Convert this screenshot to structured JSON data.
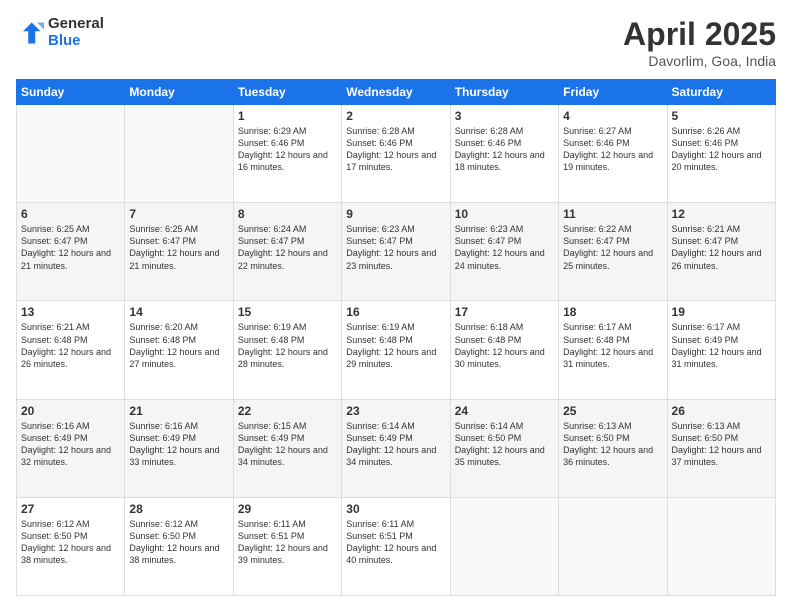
{
  "header": {
    "logo_line1": "General",
    "logo_line2": "Blue",
    "month_title": "April 2025",
    "subtitle": "Davorlim, Goa, India"
  },
  "weekdays": [
    "Sunday",
    "Monday",
    "Tuesday",
    "Wednesday",
    "Thursday",
    "Friday",
    "Saturday"
  ],
  "weeks": [
    [
      {
        "day": null
      },
      {
        "day": null
      },
      {
        "day": "1",
        "sunrise": "Sunrise: 6:29 AM",
        "sunset": "Sunset: 6:46 PM",
        "daylight": "Daylight: 12 hours and 16 minutes."
      },
      {
        "day": "2",
        "sunrise": "Sunrise: 6:28 AM",
        "sunset": "Sunset: 6:46 PM",
        "daylight": "Daylight: 12 hours and 17 minutes."
      },
      {
        "day": "3",
        "sunrise": "Sunrise: 6:28 AM",
        "sunset": "Sunset: 6:46 PM",
        "daylight": "Daylight: 12 hours and 18 minutes."
      },
      {
        "day": "4",
        "sunrise": "Sunrise: 6:27 AM",
        "sunset": "Sunset: 6:46 PM",
        "daylight": "Daylight: 12 hours and 19 minutes."
      },
      {
        "day": "5",
        "sunrise": "Sunrise: 6:26 AM",
        "sunset": "Sunset: 6:46 PM",
        "daylight": "Daylight: 12 hours and 20 minutes."
      }
    ],
    [
      {
        "day": "6",
        "sunrise": "Sunrise: 6:25 AM",
        "sunset": "Sunset: 6:47 PM",
        "daylight": "Daylight: 12 hours and 21 minutes."
      },
      {
        "day": "7",
        "sunrise": "Sunrise: 6:25 AM",
        "sunset": "Sunset: 6:47 PM",
        "daylight": "Daylight: 12 hours and 21 minutes."
      },
      {
        "day": "8",
        "sunrise": "Sunrise: 6:24 AM",
        "sunset": "Sunset: 6:47 PM",
        "daylight": "Daylight: 12 hours and 22 minutes."
      },
      {
        "day": "9",
        "sunrise": "Sunrise: 6:23 AM",
        "sunset": "Sunset: 6:47 PM",
        "daylight": "Daylight: 12 hours and 23 minutes."
      },
      {
        "day": "10",
        "sunrise": "Sunrise: 6:23 AM",
        "sunset": "Sunset: 6:47 PM",
        "daylight": "Daylight: 12 hours and 24 minutes."
      },
      {
        "day": "11",
        "sunrise": "Sunrise: 6:22 AM",
        "sunset": "Sunset: 6:47 PM",
        "daylight": "Daylight: 12 hours and 25 minutes."
      },
      {
        "day": "12",
        "sunrise": "Sunrise: 6:21 AM",
        "sunset": "Sunset: 6:47 PM",
        "daylight": "Daylight: 12 hours and 26 minutes."
      }
    ],
    [
      {
        "day": "13",
        "sunrise": "Sunrise: 6:21 AM",
        "sunset": "Sunset: 6:48 PM",
        "daylight": "Daylight: 12 hours and 26 minutes."
      },
      {
        "day": "14",
        "sunrise": "Sunrise: 6:20 AM",
        "sunset": "Sunset: 6:48 PM",
        "daylight": "Daylight: 12 hours and 27 minutes."
      },
      {
        "day": "15",
        "sunrise": "Sunrise: 6:19 AM",
        "sunset": "Sunset: 6:48 PM",
        "daylight": "Daylight: 12 hours and 28 minutes."
      },
      {
        "day": "16",
        "sunrise": "Sunrise: 6:19 AM",
        "sunset": "Sunset: 6:48 PM",
        "daylight": "Daylight: 12 hours and 29 minutes."
      },
      {
        "day": "17",
        "sunrise": "Sunrise: 6:18 AM",
        "sunset": "Sunset: 6:48 PM",
        "daylight": "Daylight: 12 hours and 30 minutes."
      },
      {
        "day": "18",
        "sunrise": "Sunrise: 6:17 AM",
        "sunset": "Sunset: 6:48 PM",
        "daylight": "Daylight: 12 hours and 31 minutes."
      },
      {
        "day": "19",
        "sunrise": "Sunrise: 6:17 AM",
        "sunset": "Sunset: 6:49 PM",
        "daylight": "Daylight: 12 hours and 31 minutes."
      }
    ],
    [
      {
        "day": "20",
        "sunrise": "Sunrise: 6:16 AM",
        "sunset": "Sunset: 6:49 PM",
        "daylight": "Daylight: 12 hours and 32 minutes."
      },
      {
        "day": "21",
        "sunrise": "Sunrise: 6:16 AM",
        "sunset": "Sunset: 6:49 PM",
        "daylight": "Daylight: 12 hours and 33 minutes."
      },
      {
        "day": "22",
        "sunrise": "Sunrise: 6:15 AM",
        "sunset": "Sunset: 6:49 PM",
        "daylight": "Daylight: 12 hours and 34 minutes."
      },
      {
        "day": "23",
        "sunrise": "Sunrise: 6:14 AM",
        "sunset": "Sunset: 6:49 PM",
        "daylight": "Daylight: 12 hours and 34 minutes."
      },
      {
        "day": "24",
        "sunrise": "Sunrise: 6:14 AM",
        "sunset": "Sunset: 6:50 PM",
        "daylight": "Daylight: 12 hours and 35 minutes."
      },
      {
        "day": "25",
        "sunrise": "Sunrise: 6:13 AM",
        "sunset": "Sunset: 6:50 PM",
        "daylight": "Daylight: 12 hours and 36 minutes."
      },
      {
        "day": "26",
        "sunrise": "Sunrise: 6:13 AM",
        "sunset": "Sunset: 6:50 PM",
        "daylight": "Daylight: 12 hours and 37 minutes."
      }
    ],
    [
      {
        "day": "27",
        "sunrise": "Sunrise: 6:12 AM",
        "sunset": "Sunset: 6:50 PM",
        "daylight": "Daylight: 12 hours and 38 minutes."
      },
      {
        "day": "28",
        "sunrise": "Sunrise: 6:12 AM",
        "sunset": "Sunset: 6:50 PM",
        "daylight": "Daylight: 12 hours and 38 minutes."
      },
      {
        "day": "29",
        "sunrise": "Sunrise: 6:11 AM",
        "sunset": "Sunset: 6:51 PM",
        "daylight": "Daylight: 12 hours and 39 minutes."
      },
      {
        "day": "30",
        "sunrise": "Sunrise: 6:11 AM",
        "sunset": "Sunset: 6:51 PM",
        "daylight": "Daylight: 12 hours and 40 minutes."
      },
      {
        "day": null
      },
      {
        "day": null
      },
      {
        "day": null
      }
    ]
  ]
}
